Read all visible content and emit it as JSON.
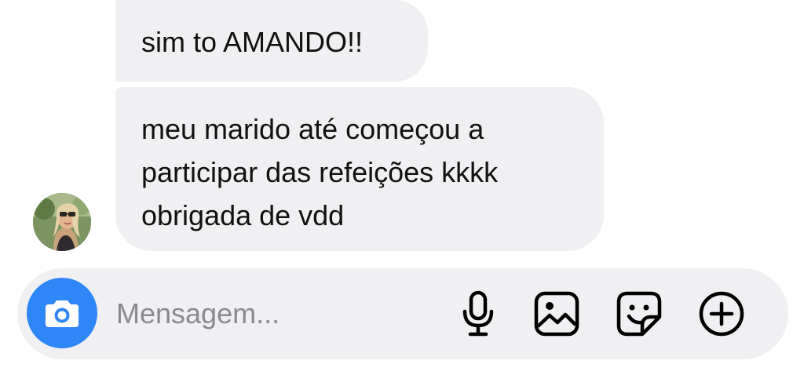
{
  "messages": [
    {
      "lines": [
        "sim to AMANDO!!"
      ]
    },
    {
      "lines": [
        "meu marido até começou a",
        "participar das refeições kkkk",
        "obrigada de vdd"
      ]
    }
  ],
  "composer": {
    "placeholder": "Mensagem...",
    "actions": [
      "camera-icon",
      "microphone-icon",
      "gallery-icon",
      "sticker-icon",
      "plus-icon"
    ]
  },
  "colors": {
    "bubble_bg": "#f0f0f3",
    "composer_bg": "#f0f0f3",
    "camera_button": "#2f86f6",
    "placeholder_text": "#8a8a8e",
    "text": "#111111"
  }
}
